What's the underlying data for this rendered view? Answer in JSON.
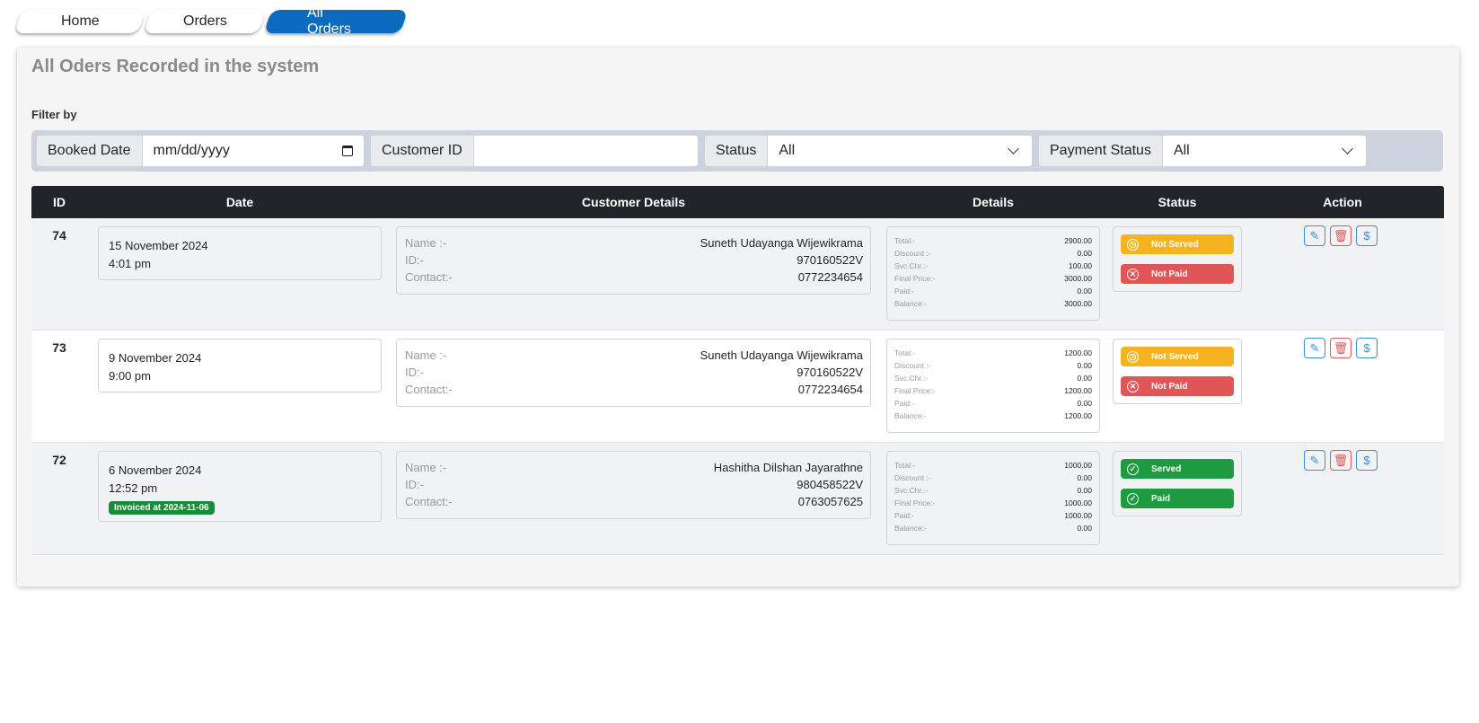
{
  "breadcrumb": [
    "Home",
    "Orders",
    "All Orders"
  ],
  "page": {
    "title": "All Oders Recorded in the system",
    "filter_label": "Filter by"
  },
  "filters": {
    "booked_date": {
      "label": "Booked Date",
      "value": "mm/dd/yyyy"
    },
    "customer_id": {
      "label": "Customer ID",
      "value": ""
    },
    "status": {
      "label": "Status",
      "value": "All"
    },
    "payment_status": {
      "label": "Payment Status",
      "value": "All"
    }
  },
  "table": {
    "headers": [
      "ID",
      "Date",
      "Customer Details",
      "Details",
      "Status",
      "Action"
    ],
    "customer_keys": [
      "Name :-",
      "ID:-",
      "Contact:-"
    ],
    "detail_keys": [
      "Total:-",
      "Discount :-",
      "Svc.Chr.:-",
      "Final Price:-",
      "Paid:-",
      "Balance:-"
    ],
    "rows": [
      {
        "id": "74",
        "date": "15 November 2024",
        "time": "4:01 pm",
        "invoice": "",
        "name": "Suneth Udayanga Wijewikrama",
        "nic": "970160522V",
        "contact": "0772234654",
        "details": [
          "2900.00",
          "0.00",
          "100.00",
          "3000.00",
          "0.00",
          "3000.00"
        ],
        "serve_status": "Not Served",
        "pay_status": "Not Paid"
      },
      {
        "id": "73",
        "date": "9 November 2024",
        "time": "9:00 pm",
        "invoice": "",
        "name": "Suneth Udayanga Wijewikrama",
        "nic": "970160522V",
        "contact": "0772234654",
        "details": [
          "1200.00",
          "0.00",
          "0.00",
          "1200.00",
          "0.00",
          "1200.00"
        ],
        "serve_status": "Not Served",
        "pay_status": "Not Paid"
      },
      {
        "id": "72",
        "date": "6 November 2024",
        "time": "12:52 pm",
        "invoice": "Invoiced at 2024-11-06",
        "name": "Hashitha Dilshan Jayarathne",
        "nic": "980458522V",
        "contact": "0763057625",
        "details": [
          "1000.00",
          "0.00",
          "0.00",
          "1000.00",
          "1000.00",
          "0.00"
        ],
        "serve_status": "Served",
        "pay_status": "Paid"
      }
    ]
  },
  "colors": {
    "not_served": "#f5b320",
    "not_paid": "#e05555",
    "served": "#1e9b40",
    "paid": "#1e9b40",
    "active_tab": "#0b6bbf",
    "header_bg": "#212529"
  },
  "icons": {
    "calendar": "calendar-icon",
    "edit": "pencil-icon",
    "delete": "trash-icon",
    "pay": "dollar-icon",
    "not_served": "alarm-clock-icon",
    "not_paid": "x-circle-icon",
    "served": "check-circle-icon",
    "paid": "check-circle-icon"
  }
}
